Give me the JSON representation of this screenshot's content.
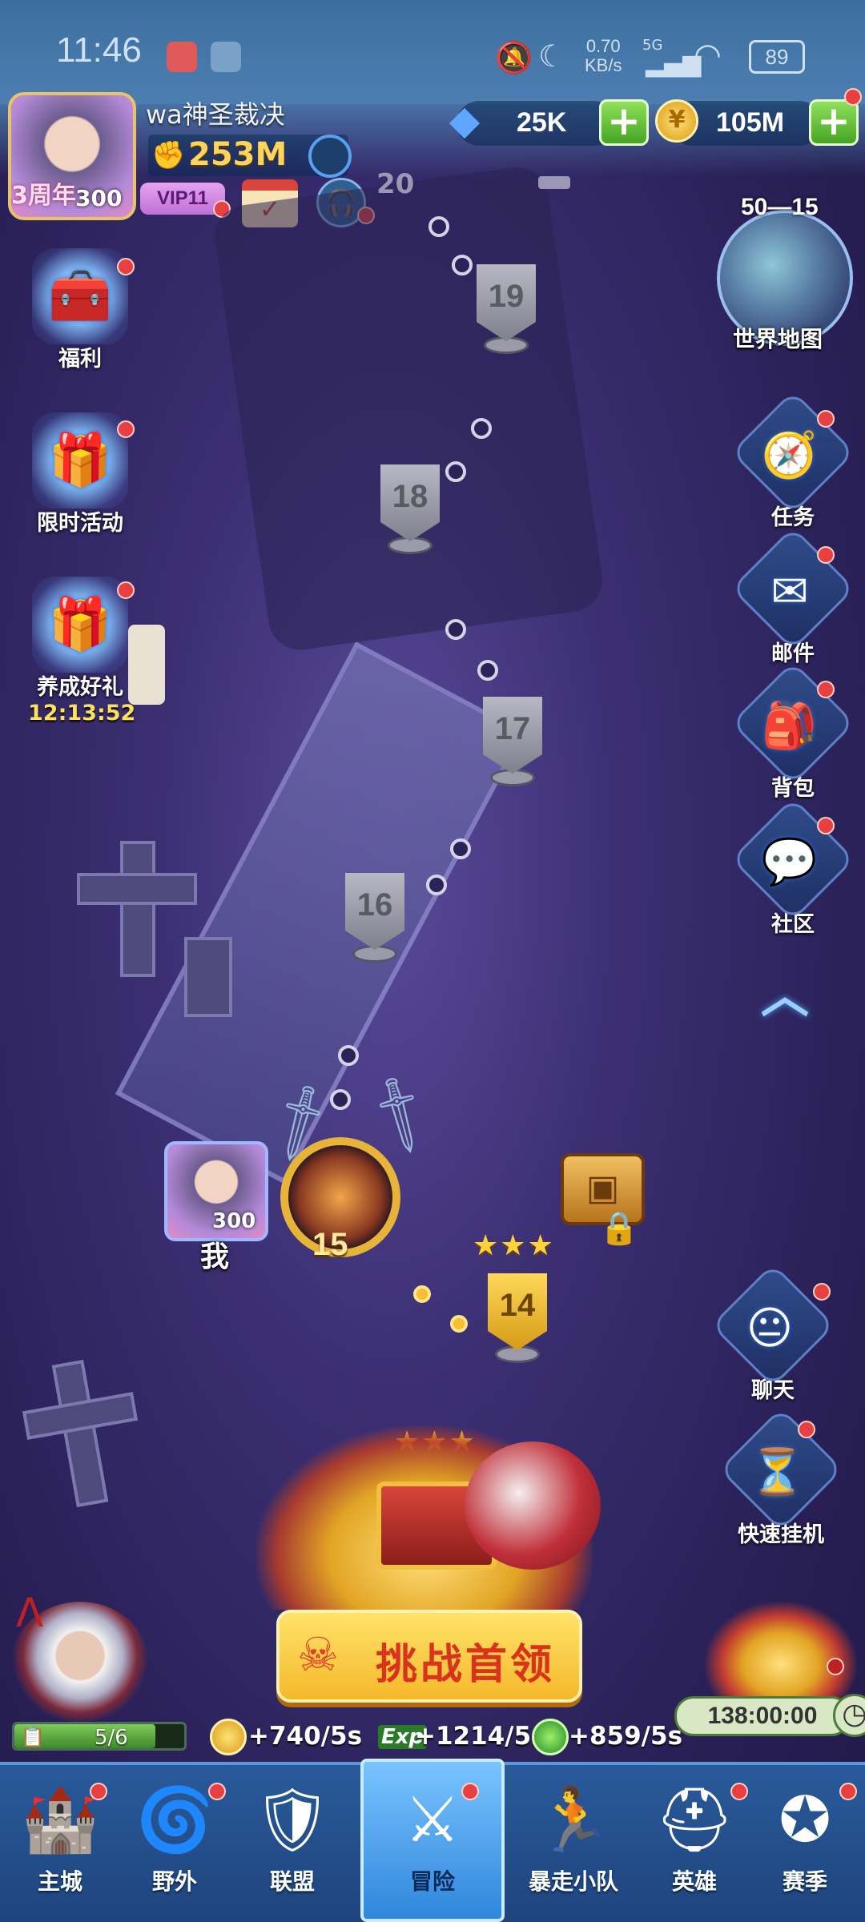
{
  "status_bar": {
    "time": "11:46",
    "net_speed": "0.70",
    "net_unit": "KB/s",
    "signal": "5G",
    "battery": "89"
  },
  "player": {
    "name": "wa神圣裁决",
    "power": "253M",
    "vip": "VIP11",
    "level": "300",
    "event_badge": "3周年"
  },
  "currency": {
    "gems": "25K",
    "gold": "105M",
    "plus": "+"
  },
  "world_map": {
    "stage": "50—15",
    "label": "世界地图"
  },
  "left_menu": {
    "welfare": "福利",
    "limited_event": "限时活动",
    "growth_gift": "养成好礼",
    "growth_timer": "12:13:52"
  },
  "right_menu": {
    "quest": "任务",
    "mail": "邮件",
    "bag": "背包",
    "community": "社区",
    "chat": "聊天",
    "quick_idle": "快速挂机"
  },
  "stages": {
    "s19": "19",
    "s18": "18",
    "s17": "17",
    "s16": "16",
    "s15": "15",
    "s14": "14",
    "s20": "20"
  },
  "me": {
    "label": "我",
    "level": "300"
  },
  "challenge_button": "挑战首领",
  "energy": "5/6",
  "rates": {
    "gold": "+740/5s",
    "exp_label": "Exp",
    "exp": "+1214/5s",
    "stone": "+859/5s"
  },
  "afk_timer": "138:00:00",
  "nav": {
    "main_city": "主城",
    "wild": "野外",
    "alliance": "联盟",
    "adventure": "冒险",
    "squad": "暴走小队",
    "hero": "英雄",
    "season": "赛季"
  },
  "colors": {
    "accent_gold": "#ffd35c",
    "badge_red": "#e84040",
    "nav_blue": "#2a5a9a"
  }
}
